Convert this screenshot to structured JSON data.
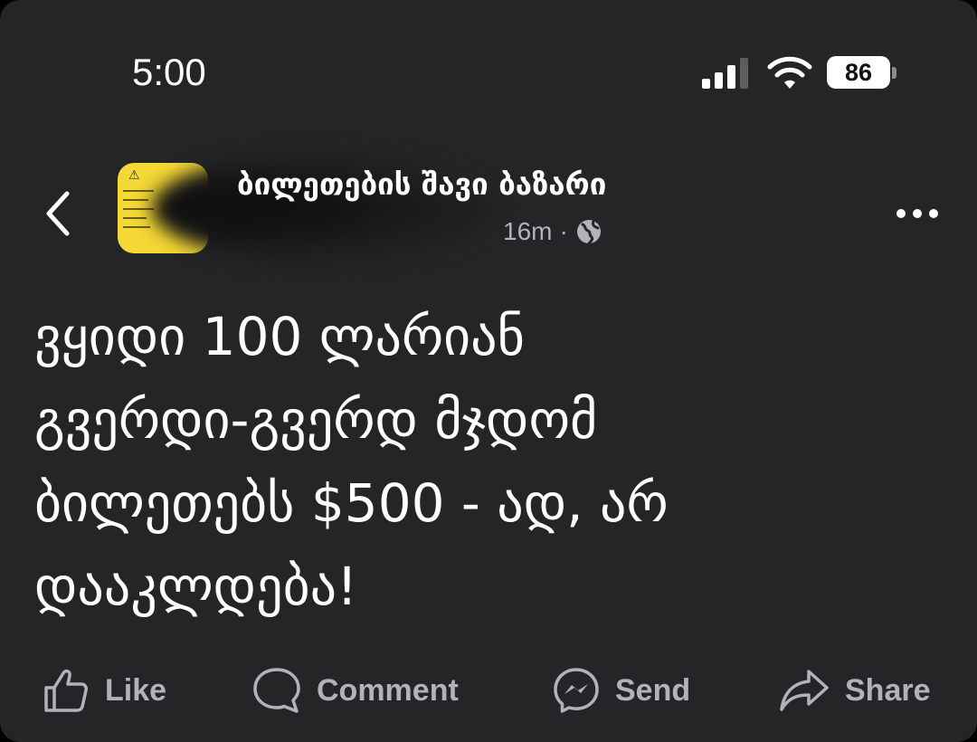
{
  "status_bar": {
    "time": "5:00",
    "battery": "86",
    "signal_bars_active": 3,
    "signal_bars_total": 4
  },
  "post": {
    "group_name": "ბილეთების შავი ბაზარი",
    "timestamp": "16m",
    "separator": "·",
    "privacy_icon": "globe-icon",
    "text": "ვყიდი 100 ლარიან\nგვერდი-გვერდ მჯდომ\nბილეთებს $500 - ად, არ\nდააკლდება!"
  },
  "actions": {
    "like": "Like",
    "comment": "Comment",
    "send": "Send",
    "share": "Share"
  },
  "colors": {
    "background": "#242526",
    "text": "#ffffff",
    "secondary_text": "#b0b3b8",
    "avatar_yellow": "#f4d835"
  }
}
